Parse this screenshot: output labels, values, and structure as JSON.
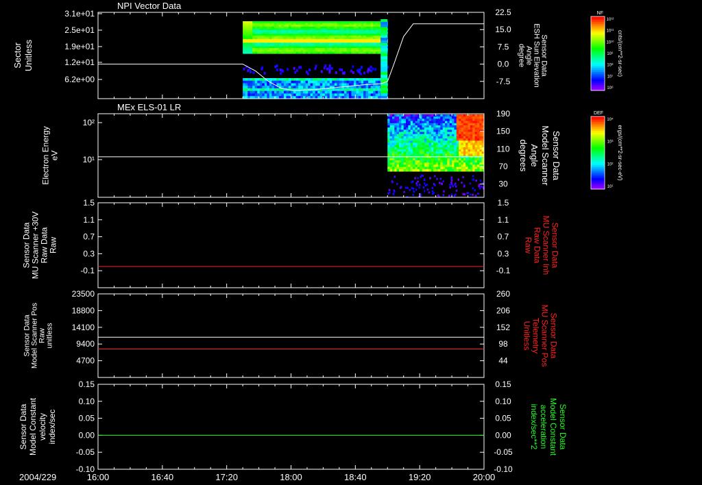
{
  "date_label": "2004/229",
  "x_axis": {
    "ticks": [
      "16:00",
      "16:40",
      "17:20",
      "18:00",
      "18:40",
      "19:20",
      "20:00"
    ],
    "range_minutes": [
      960,
      1200
    ]
  },
  "colors": {
    "white_trace": "#ffffff",
    "red_trace": "#ff2020",
    "green_trace": "#20ff20",
    "axis": "#ffffff"
  },
  "chart_data": [
    {
      "type": "heatmap",
      "title": "NPI Vector Data",
      "ylabel_left": [
        "Sector",
        "Unitless"
      ],
      "ylabel_right": [
        "Sensor Data",
        "ESH Sun Elevation",
        "Angle",
        "degree"
      ],
      "left_ticks": [
        "3.1e+01",
        "2.5e+01",
        "1.9e+01",
        "1.2e+01",
        "6.2e+00"
      ],
      "right_ticks": [
        "22.5",
        "15.0",
        "7.5",
        "0.0",
        "-7.5"
      ],
      "right_ylim": [
        -15,
        22.5
      ],
      "colorbar": {
        "label": "NF",
        "ticks": [
          "10¹²",
          "10¹¹",
          "10¹⁰",
          "10⁹",
          "10⁸",
          "10⁷",
          "10⁶"
        ],
        "unit": "cnts/(cm**2-sr-sec)"
      },
      "heatmap_extent_minutes": [
        1050,
        1140
      ],
      "line": {
        "x": [
          960,
          1050,
          1058,
          1066,
          1074,
          1082,
          1095,
          1110,
          1125,
          1136,
          1140,
          1144,
          1150,
          1156,
          1200
        ],
        "y": [
          0,
          0,
          -3,
          -7.5,
          -10.5,
          -11.5,
          -11,
          -10,
          -9,
          -8.5,
          -7.5,
          0,
          12,
          17.5,
          17.5
        ]
      }
    },
    {
      "type": "heatmap",
      "title": "MEx ELS-01 LR",
      "ylabel_left": [
        "Electron Energy",
        "eV"
      ],
      "ylabel_right": [
        "Sensor Data",
        "Model Scanner",
        "Angle",
        "degrees"
      ],
      "left_ticks": [
        "10²",
        "10¹"
      ],
      "right_ticks": [
        "190",
        "150",
        "110",
        "70",
        "30"
      ],
      "right_ylim": [
        0,
        190
      ],
      "colorbar": {
        "label": "DEF",
        "ticks": [
          "10⁴",
          "10³",
          "10²",
          "10¹"
        ],
        "unit": "ergs/(cm**2-sr-sec-eV)"
      },
      "heatmap_extent_minutes": [
        1140,
        1200
      ],
      "line": {
        "x": [
          960,
          1200
        ],
        "y": [
          92,
          92
        ]
      }
    },
    {
      "type": "line",
      "ylabel_left": [
        "Sensor Data",
        "MU Scanner +30V",
        "Raw Data",
        "Raw"
      ],
      "ylabel_right": [
        "Sensor Data",
        "MU Scanner Inh",
        "Raw Data",
        "Raw"
      ],
      "left_ticks": [
        "1.5",
        "1.1",
        "0.7",
        "0.3",
        "-0.1"
      ],
      "right_ticks": [
        "1.5",
        "1.1",
        "0.7",
        "0.3",
        "-0.1"
      ],
      "ylim": [
        -0.5,
        1.5
      ],
      "series": [
        {
          "color": "red",
          "x": [
            960,
            1200
          ],
          "y": [
            0,
            0
          ]
        }
      ]
    },
    {
      "type": "line",
      "ylabel_left": [
        "Sensor Data",
        "Model Scanner Pos",
        "Raw",
        "unitless"
      ],
      "ylabel_right": [
        "Sensor Data",
        "MU Scanner Pos",
        "Telemetry",
        "Unitless"
      ],
      "left_ticks": [
        "23500",
        "18800",
        "14100",
        "9400",
        "4700"
      ],
      "right_ticks": [
        "260",
        "206",
        "152",
        "98",
        "44"
      ],
      "ylim": [
        0,
        23500
      ],
      "series": [
        {
          "color": "white",
          "x": [
            960,
            1200
          ],
          "y": [
            11300,
            11300
          ]
        },
        {
          "color": "red",
          "x": [
            960,
            1200
          ],
          "y": [
            8000,
            8000
          ]
        }
      ]
    },
    {
      "type": "line",
      "ylabel_left": [
        "Sensor Data",
        "Model Constant",
        "velocity",
        "index/sec"
      ],
      "ylabel_right": [
        "Sensor Data",
        "Model Constant",
        "acceleration",
        "index/sec**2"
      ],
      "left_ticks": [
        "0.15",
        "0.10",
        "0.05",
        "0.00",
        "-0.05",
        "-0.10"
      ],
      "right_ticks": [
        "0.15",
        "0.10",
        "0.05",
        "0.00",
        "-0.05",
        "-0.10"
      ],
      "ylim": [
        -0.1,
        0.15
      ],
      "series": [
        {
          "color": "green",
          "x": [
            960,
            1200
          ],
          "y": [
            0,
            0
          ]
        }
      ]
    }
  ]
}
